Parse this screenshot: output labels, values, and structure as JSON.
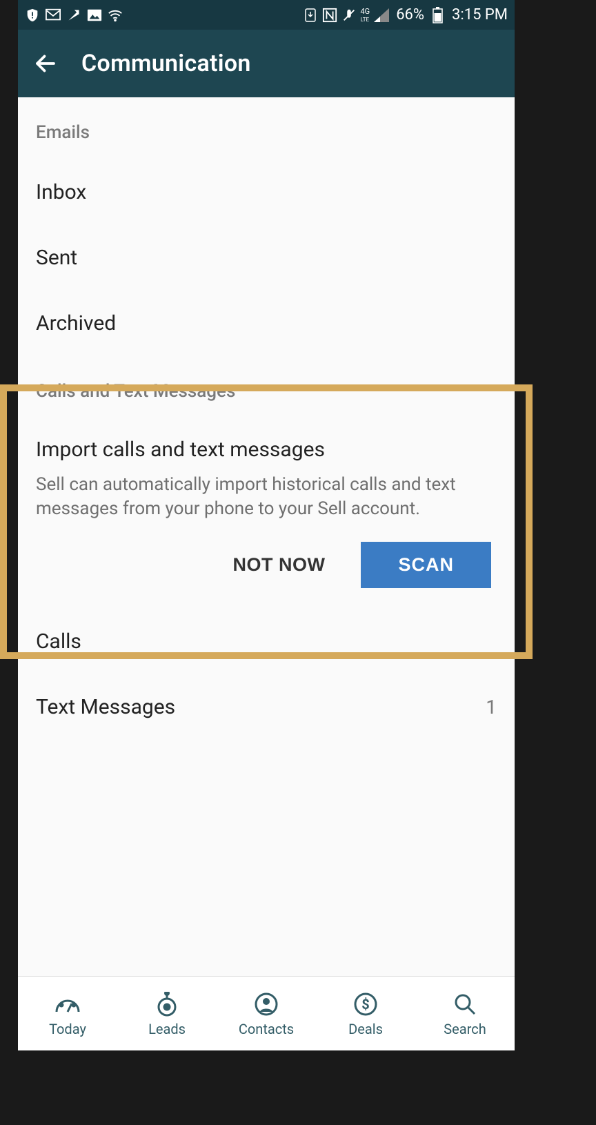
{
  "status": {
    "battery_pct": "66%",
    "clock": "3:15 PM",
    "network_4g": "4G LTE"
  },
  "header": {
    "title": "Communication"
  },
  "sections": {
    "emails": {
      "header": "Emails",
      "items": [
        {
          "label": "Inbox"
        },
        {
          "label": "Sent"
        },
        {
          "label": "Archived"
        }
      ]
    },
    "calls": {
      "header": "Calls and Text Messages",
      "import": {
        "title": "Import calls and text messages",
        "desc": "Sell can automatically import historical calls and text messages from your phone to your Sell account.",
        "not_now": "NOT NOW",
        "scan": "SCAN"
      },
      "items": [
        {
          "label": "Calls",
          "count": ""
        },
        {
          "label": "Text Messages",
          "count": "1"
        }
      ]
    }
  },
  "nav": {
    "items": [
      {
        "label": "Today"
      },
      {
        "label": "Leads"
      },
      {
        "label": "Contacts"
      },
      {
        "label": "Deals"
      },
      {
        "label": "Search"
      }
    ]
  }
}
